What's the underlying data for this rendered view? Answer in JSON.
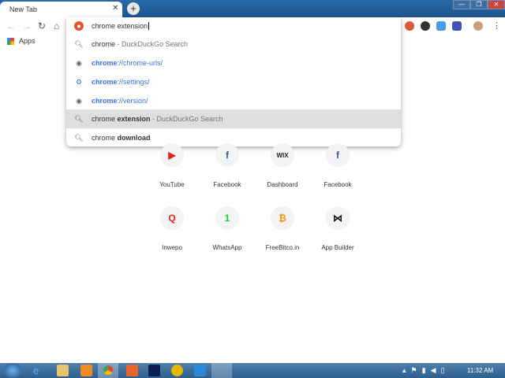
{
  "window": {
    "tab_title": "New Tab",
    "close_tab": "✕",
    "new_tab": "+",
    "minimize": "—",
    "maximize": "❐",
    "close": "✕"
  },
  "toolbar": {
    "back": "←",
    "forward": "→",
    "reload": "↻",
    "home": "⌂",
    "menu": "⋮"
  },
  "bookmarks": {
    "apps_label": "Apps"
  },
  "omnibox": {
    "value": "chrome extension",
    "suggestions": [
      {
        "icon": "search-icon",
        "bold": "",
        "text": "chrome",
        "suffix": " - DuckDuckGo Search"
      },
      {
        "icon": "globe-icon",
        "bold": "chrome",
        "text": "://chrome-urls/",
        "suffix": ""
      },
      {
        "icon": "gear-icon",
        "bold": "chrome",
        "text": "://settings/",
        "suffix": ""
      },
      {
        "icon": "globe-icon",
        "bold": "chrome",
        "text": "://version/",
        "suffix": ""
      },
      {
        "icon": "search-icon",
        "pre": "chrome ",
        "bold": "extension",
        "suffix": " - DuckDuckGo Search"
      },
      {
        "icon": "search-icon",
        "pre": "chrome ",
        "bold": "download",
        "suffix": ""
      }
    ]
  },
  "tiles": [
    {
      "label": "YouTube",
      "glyph": "▶",
      "color": "#e62117"
    },
    {
      "label": "Facebook",
      "glyph": "f",
      "color": "#3b5998"
    },
    {
      "label": "Dashboard",
      "glyph": "WIX",
      "color": "#222222"
    },
    {
      "label": "Facebook",
      "glyph": "f",
      "color": "#3b5998"
    },
    {
      "label": "Inwepo",
      "glyph": "Q",
      "color": "#e62117"
    },
    {
      "label": "WhatsApp",
      "glyph": "1",
      "color": "#25c03c"
    },
    {
      "label": "FreeBitco.in",
      "glyph": "₿",
      "color": "#f7931a"
    },
    {
      "label": "App Builder",
      "glyph": "⋈",
      "color": "#111111"
    }
  ],
  "taskbar": {
    "clock": "11:32 AM"
  }
}
